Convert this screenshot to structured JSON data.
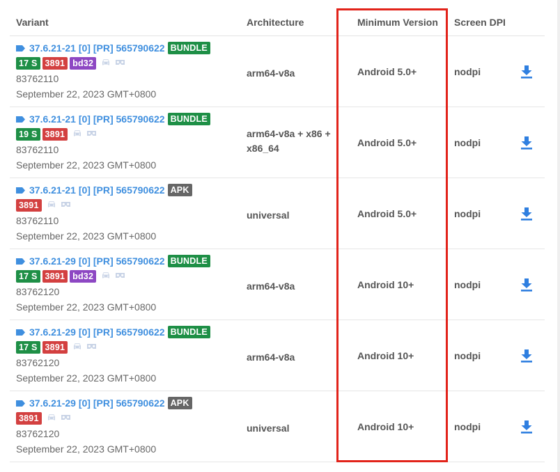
{
  "headers": {
    "variant": "Variant",
    "architecture": "Architecture",
    "min_version": "Minimum Version",
    "screen_dpi": "Screen DPI"
  },
  "rows": [
    {
      "version": "37.6.21-21 [0] [PR] 565790622",
      "type": "BUNDLE",
      "badges": [
        "17 S",
        "3891",
        "bd32"
      ],
      "code": "83762110",
      "date": "September 22, 2023 GMT+0800",
      "arch": [
        "arm64-v8a"
      ],
      "min_version": "Android 5.0+",
      "dpi": "nodpi"
    },
    {
      "version": "37.6.21-21 [0] [PR] 565790622",
      "type": "BUNDLE",
      "badges": [
        "19 S",
        "3891"
      ],
      "code": "83762110",
      "date": "September 22, 2023 GMT+0800",
      "arch": [
        "arm64-v8a + x86 +",
        "x86_64"
      ],
      "min_version": "Android 5.0+",
      "dpi": "nodpi"
    },
    {
      "version": "37.6.21-21 [0] [PR] 565790622",
      "type": "APK",
      "badges": [
        "3891"
      ],
      "code": "83762110",
      "date": "September 22, 2023 GMT+0800",
      "arch": [
        "universal"
      ],
      "min_version": "Android 5.0+",
      "dpi": "nodpi"
    },
    {
      "version": "37.6.21-29 [0] [PR] 565790622",
      "type": "BUNDLE",
      "badges": [
        "17 S",
        "3891",
        "bd32"
      ],
      "code": "83762120",
      "date": "September 22, 2023 GMT+0800",
      "arch": [
        "arm64-v8a"
      ],
      "min_version": "Android 10+",
      "dpi": "nodpi"
    },
    {
      "version": "37.6.21-29 [0] [PR] 565790622",
      "type": "BUNDLE",
      "badges": [
        "17 S",
        "3891"
      ],
      "code": "83762120",
      "date": "September 22, 2023 GMT+0800",
      "arch": [
        "arm64-v8a"
      ],
      "min_version": "Android 10+",
      "dpi": "nodpi"
    },
    {
      "version": "37.6.21-29 [0] [PR] 565790622",
      "type": "APK",
      "badges": [
        "3891"
      ],
      "code": "83762120",
      "date": "September 22, 2023 GMT+0800",
      "arch": [
        "universal"
      ],
      "min_version": "Android 10+",
      "dpi": "nodpi"
    }
  ],
  "icons": {
    "tag": "tag-icon",
    "car": "car-icon",
    "vr": "vr-headset-icon",
    "download": "download-icon"
  },
  "colors": {
    "link": "#3f8fdf",
    "bundle": "#1e8f46",
    "apk": "#666666",
    "red_badge": "#d34040",
    "purple_badge": "#8d47c3",
    "highlight": "#e2231a",
    "download": "#2f7fe0"
  }
}
